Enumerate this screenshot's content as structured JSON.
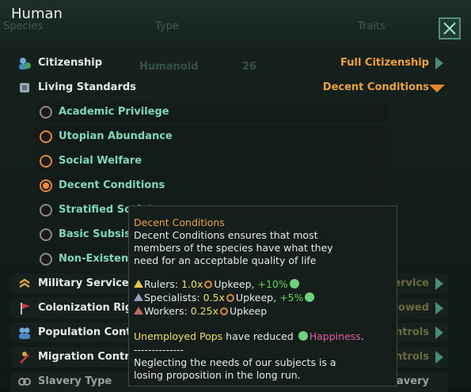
{
  "window": {
    "title": "Human"
  },
  "background_table": {
    "headers": [
      "Species",
      "Type",
      "Traits"
    ],
    "row": {
      "type": "Humanoid",
      "count": "26"
    }
  },
  "policies": [
    {
      "label": "Citizenship",
      "value": "Full Citizenship",
      "icon": "citizenship-icon"
    },
    {
      "label": "Living Standards",
      "value": "Decent Conditions",
      "icon": "living-standards-icon"
    },
    {
      "label": "Military Service",
      "value": "Full Military Service",
      "icon": "military-service-icon"
    },
    {
      "label": "Colonization Rights",
      "value": "Colonization Allowed",
      "icon": "colonization-icon"
    },
    {
      "label": "Population Controls",
      "value": "No Population Controls",
      "icon": "population-icon"
    },
    {
      "label": "Migration Controls",
      "value": "No Migration Controls",
      "icon": "migration-icon"
    },
    {
      "label": "Slavery Type",
      "value": "Chattel Slavery",
      "icon": "slavery-icon"
    }
  ],
  "living_standards_options": [
    {
      "label": "Academic Privilege",
      "state": "available"
    },
    {
      "label": "Utopian Abundance",
      "state": "orange"
    },
    {
      "label": "Social Welfare",
      "state": "orange"
    },
    {
      "label": "Decent Conditions",
      "state": "selected"
    },
    {
      "label": "Stratified Society",
      "state": "available"
    },
    {
      "label": "Basic Subsistence",
      "state": "available"
    },
    {
      "label": "Non-Existent",
      "state": "available"
    }
  ],
  "tooltip": {
    "title": "Decent Conditions",
    "desc": [
      "Decent Conditions ensures that most",
      "members of the species have what they",
      "need for an acceptable quality of life"
    ],
    "rulers": {
      "label": "Rulers:",
      "mult": "1.0x",
      "upkeep": "Upkeep,",
      "bonus": "+10%"
    },
    "specialists": {
      "label": "Specialists:",
      "mult": "0.5x",
      "upkeep": "Upkeep,",
      "bonus": "+5%"
    },
    "workers": {
      "label": "Workers:",
      "mult": "0.25x",
      "upkeep": "Upkeep"
    },
    "unemployed": {
      "a": "Unemployed Pops",
      "b": "have reduced",
      "c": "Happiness",
      "d": "."
    },
    "separator": "--------------",
    "neglect": [
      "Neglecting the needs of our subjects is a",
      "losing proposition in the long run."
    ]
  }
}
